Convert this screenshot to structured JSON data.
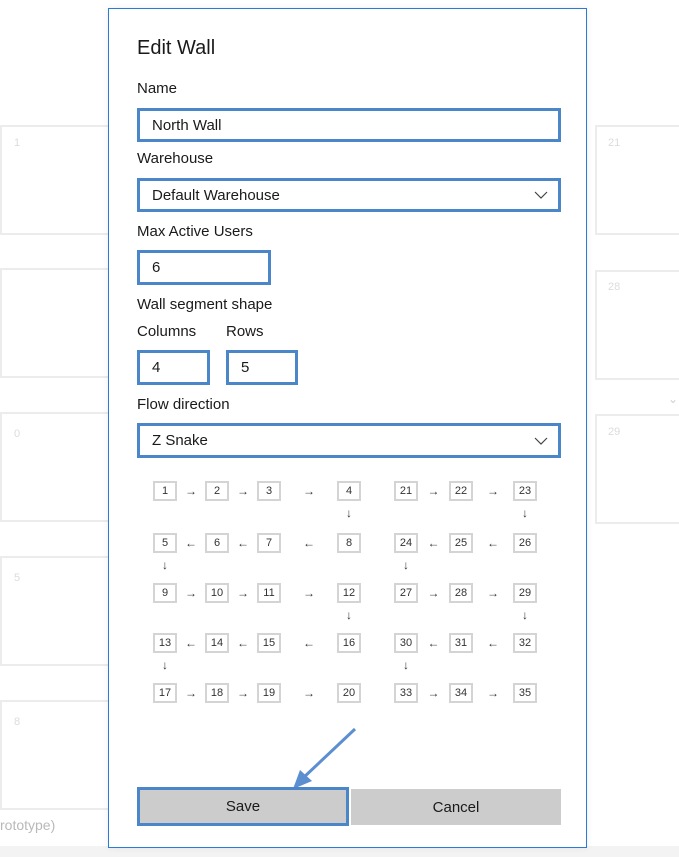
{
  "background": {
    "card_numbers": [
      "1",
      "21",
      "28",
      "29",
      "5",
      "0",
      "8"
    ],
    "footer_text": "rototype)"
  },
  "dialog": {
    "title": "Edit Wall",
    "name_label": "Name",
    "name_value": "North Wall",
    "warehouse_label": "Warehouse",
    "warehouse_value": "Default Warehouse",
    "max_users_label": "Max Active Users",
    "max_users_value": "6",
    "shape_label": "Wall segment shape",
    "columns_label": "Columns",
    "rows_label": "Rows",
    "columns_value": "4",
    "rows_value": "5",
    "flow_label": "Flow direction",
    "flow_value": "Z Snake",
    "save_label": "Save",
    "cancel_label": "Cancel"
  },
  "flow_preview": {
    "arrows": {
      "right": "→",
      "left": "←",
      "down": "↓"
    },
    "segment_a": [
      [
        "1",
        "2",
        "3",
        "4"
      ],
      [
        "8",
        "7",
        "6",
        "5"
      ],
      [
        "9",
        "10",
        "11",
        "12"
      ],
      [
        "16",
        "15",
        "14",
        "13"
      ],
      [
        "17",
        "18",
        "19",
        "20"
      ]
    ],
    "segment_b": [
      [
        "21",
        "22",
        "23"
      ],
      [
        "26",
        "25",
        "24"
      ],
      [
        "27",
        "28",
        "29"
      ],
      [
        "32",
        "31",
        "30"
      ],
      [
        "33",
        "34",
        "35"
      ]
    ]
  },
  "colors": {
    "accent_border": "#4a86c8",
    "button_bg": "#cccccc",
    "cell_border": "#d4d4d4",
    "pointer_arrow": "#5b8fd0"
  }
}
